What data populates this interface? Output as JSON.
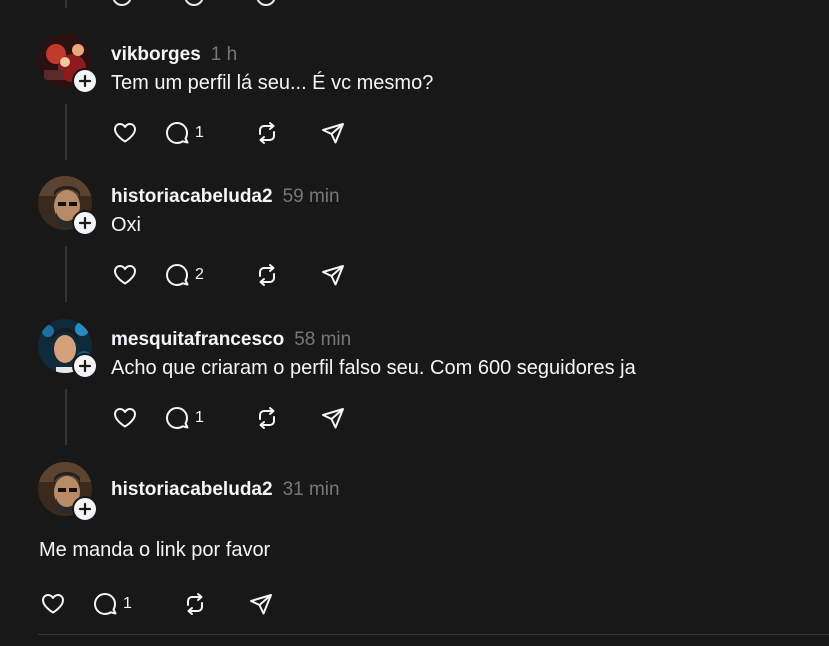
{
  "replies": [
    {
      "username": "vikborges",
      "time": "1 h",
      "text": "Tem um perfil lá seu... É vc mesmo?",
      "replies_count": "1"
    },
    {
      "username": "historiacabeluda2",
      "time": "59 min",
      "text": "Oxi",
      "replies_count": "2"
    },
    {
      "username": "mesquitafrancesco",
      "time": "58 min",
      "text": "Acho que criaram o perfil falso seu. Com 600 seguidores ja",
      "replies_count": "1"
    },
    {
      "username": "historiacabeluda2",
      "time": "31 min",
      "text": "Me manda o link por favor",
      "replies_count": "1"
    }
  ],
  "icons": {
    "like": "heart-icon",
    "reply": "comment-icon",
    "repost": "repost-icon",
    "share": "send-icon",
    "follow": "plus-icon"
  },
  "colors": {
    "background": "#181818",
    "text": "#f3f5f7",
    "muted": "#777777",
    "line": "#333638"
  }
}
